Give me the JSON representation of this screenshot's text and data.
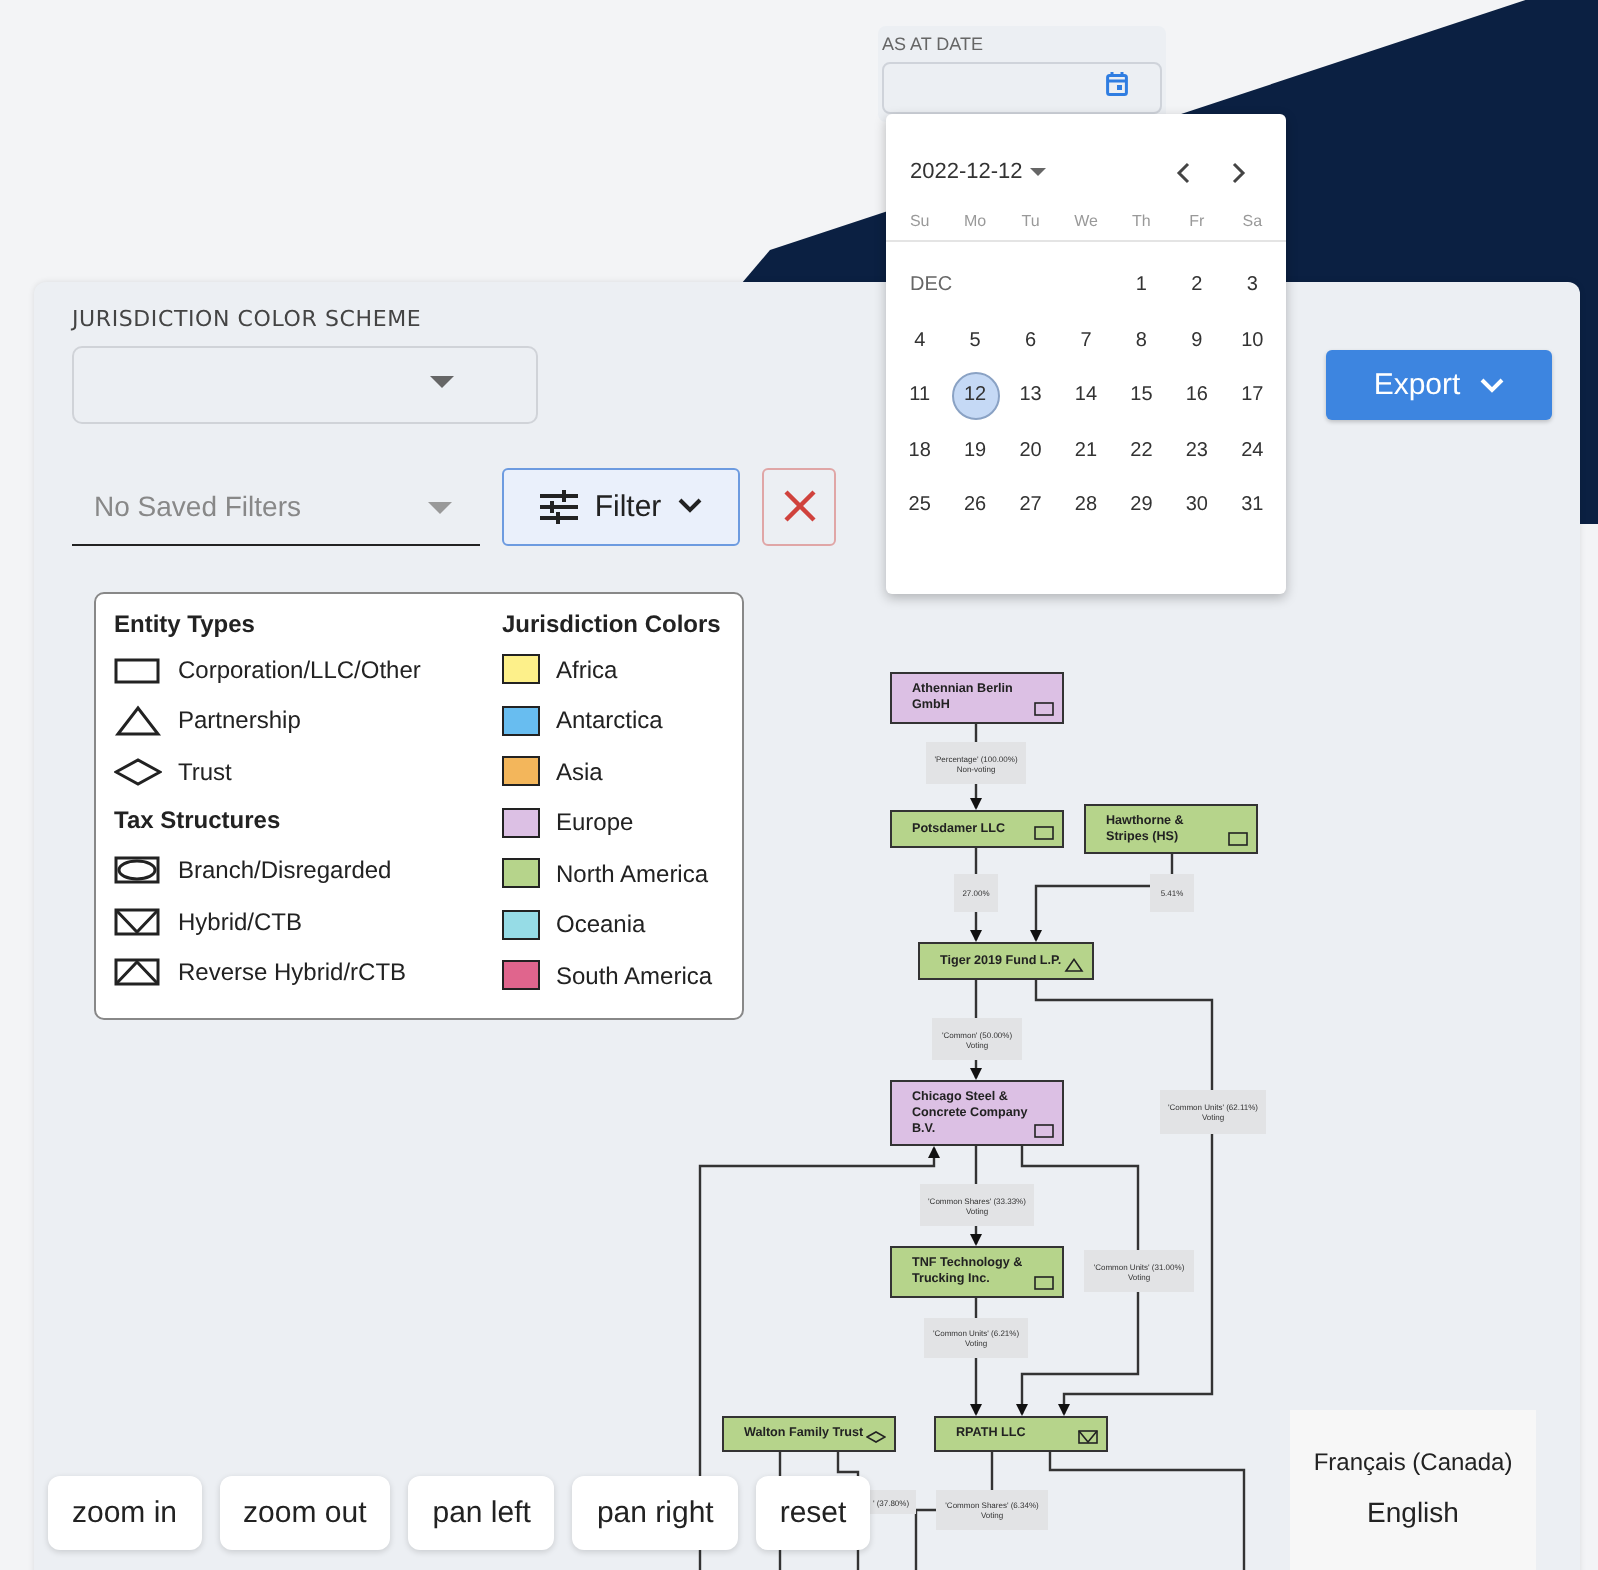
{
  "date_field": {
    "label": "AS AT DATE"
  },
  "date_picker": {
    "current": "2022-12-12",
    "weekdays": [
      "Su",
      "Mo",
      "Tu",
      "We",
      "Th",
      "Fr",
      "Sa"
    ],
    "month_label": "DEC",
    "weeks": [
      [
        {
          "day": "1",
          "selected": false
        },
        {
          "day": "2",
          "selected": false
        },
        {
          "day": "3",
          "selected": false
        }
      ],
      [
        {
          "day": "4",
          "selected": false
        },
        {
          "day": "5",
          "selected": false
        },
        {
          "day": "6",
          "selected": false
        },
        {
          "day": "7",
          "selected": false
        },
        {
          "day": "8",
          "selected": false
        },
        {
          "day": "9",
          "selected": false
        },
        {
          "day": "10",
          "selected": false
        }
      ],
      [
        {
          "day": "11",
          "selected": false
        },
        {
          "day": "12",
          "selected": true
        },
        {
          "day": "13",
          "selected": false
        },
        {
          "day": "14",
          "selected": false
        },
        {
          "day": "15",
          "selected": false
        },
        {
          "day": "16",
          "selected": false
        },
        {
          "day": "17",
          "selected": false
        }
      ],
      [
        {
          "day": "18",
          "selected": false
        },
        {
          "day": "19",
          "selected": false
        },
        {
          "day": "20",
          "selected": false
        },
        {
          "day": "21",
          "selected": false
        },
        {
          "day": "22",
          "selected": false
        },
        {
          "day": "23",
          "selected": false
        },
        {
          "day": "24",
          "selected": false
        }
      ],
      [
        {
          "day": "25",
          "selected": false
        },
        {
          "day": "26",
          "selected": false
        },
        {
          "day": "27",
          "selected": false
        },
        {
          "day": "28",
          "selected": false
        },
        {
          "day": "29",
          "selected": false
        },
        {
          "day": "30",
          "selected": false
        },
        {
          "day": "31",
          "selected": false
        }
      ]
    ]
  },
  "color_scheme": {
    "label": "JURISDICTION COLOR SCHEME"
  },
  "saved_filters": {
    "placeholder": "No Saved Filters"
  },
  "filter_button": {
    "label": "Filter"
  },
  "export_button": {
    "label": "Export"
  },
  "legend": {
    "entity_types": {
      "title": "Entity Types",
      "items": [
        {
          "label": "Corporation/LLC/Other",
          "kind": "rectangle"
        },
        {
          "label": "Partnership",
          "kind": "triangle"
        },
        {
          "label": "Trust",
          "kind": "diamond"
        }
      ]
    },
    "tax_structures": {
      "title": "Tax Structures",
      "items": [
        {
          "label": "Branch/Disregarded",
          "kind": "branch"
        },
        {
          "label": "Hybrid/CTB",
          "kind": "hybrid"
        },
        {
          "label": "Reverse Hybrid/rCTB",
          "kind": "reverse"
        }
      ]
    },
    "jurisdiction_colors": {
      "title": "Jurisdiction Colors",
      "items": [
        {
          "label": "Africa",
          "color": "#fdf08a"
        },
        {
          "label": "Antarctica",
          "color": "#68bdf0"
        },
        {
          "label": "Asia",
          "color": "#f3b65b"
        },
        {
          "label": "Europe",
          "color": "#dcc0e4"
        },
        {
          "label": "North America",
          "color": "#b6d48b"
        },
        {
          "label": "Oceania",
          "color": "#96dce6"
        },
        {
          "label": "South America",
          "color": "#e0658d"
        }
      ]
    }
  },
  "diagram": {
    "nodes": [
      {
        "name": "Athennian Berlin GmbH",
        "color": "#dcc0e4",
        "kind": "rectangle"
      },
      {
        "name": "Potsdamer LLC",
        "color": "#b6d48b",
        "kind": "rectangle"
      },
      {
        "name": "Hawthorne & Stripes (HS)",
        "color": "#b6d48b",
        "kind": "rectangle"
      },
      {
        "name": "Tiger 2019 Fund L.P.",
        "color": "#b6d48b",
        "kind": "triangle"
      },
      {
        "name": "Chicago Steel & Concrete Company B.V.",
        "color": "#dcc0e4",
        "kind": "rectangle"
      },
      {
        "name": "TNF Technology & Trucking Inc.",
        "color": "#b6d48b",
        "kind": "rectangle"
      },
      {
        "name": "Walton Family Trust",
        "color": "#b6d48b",
        "kind": "diamond"
      },
      {
        "name": "RPATH LLC",
        "color": "#b6d48b",
        "kind": "hybrid"
      }
    ],
    "edge_labels": [
      {
        "lines": [
          "'Percentage' (100.00%)",
          "Non-voting"
        ]
      },
      {
        "lines": [
          "27.00%"
        ]
      },
      {
        "lines": [
          "5.41%"
        ]
      },
      {
        "lines": [
          "'Common' (50.00%)",
          "Voting"
        ]
      },
      {
        "lines": [
          "'Common Units' (62.11%)",
          "Voting"
        ]
      },
      {
        "lines": [
          "'Common Shares' (33.33%)",
          "Voting"
        ]
      },
      {
        "lines": [
          "'Common Units' (31.00%)",
          "Voting"
        ]
      },
      {
        "lines": [
          "'Common Units' (6.21%)",
          "Voting"
        ]
      },
      {
        "lines": [
          "' (37.80%)"
        ]
      },
      {
        "lines": [
          "'Common Shares' (6.34%)",
          "Voting"
        ]
      }
    ]
  },
  "zoom_controls": [
    "zoom in",
    "zoom out",
    "pan left",
    "pan right",
    "reset"
  ],
  "language_menu": [
    {
      "label": "Français (Canada)"
    },
    {
      "label": "English"
    }
  ]
}
